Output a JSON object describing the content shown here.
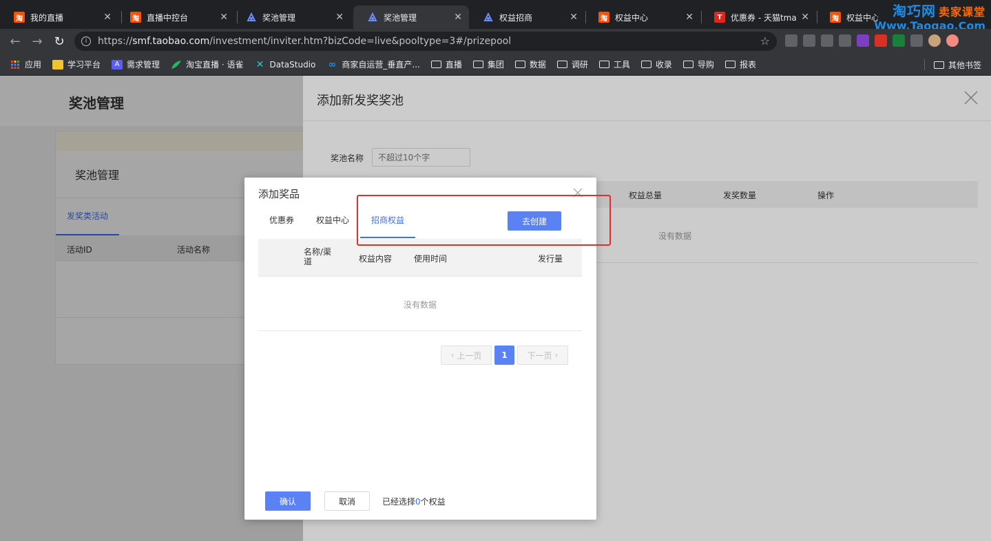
{
  "browser": {
    "tabs": [
      {
        "title": "我的直播",
        "favicon": "taobao-icon"
      },
      {
        "title": "直播中控台",
        "favicon": "taobao-icon"
      },
      {
        "title": "奖池管理",
        "favicon": "blue-logo-icon"
      },
      {
        "title": "奖池管理",
        "favicon": "blue-logo-icon",
        "active": true
      },
      {
        "title": "权益招商",
        "favicon": "blue-logo-icon"
      },
      {
        "title": "权益中心",
        "favicon": "taobao-icon"
      },
      {
        "title": "优惠券 - 天猫tmall",
        "favicon": "tmall-icon"
      },
      {
        "title": "权益中心",
        "favicon": "taobao-icon"
      }
    ],
    "favicon_letters": {
      "taobao": "淘",
      "tmall": "T"
    },
    "url": {
      "scheme": "https://",
      "host": "smf.taobao.com",
      "path": "/investment/inviter.htm?bizCode=live&pooltype=3#/prizepool"
    },
    "bookmarks": [
      {
        "label": "应用",
        "icon": "apps-grid-icon"
      },
      {
        "label": "学习平台",
        "icon": "study-icon"
      },
      {
        "label": "需求管理",
        "icon": "letter-a-icon"
      },
      {
        "label": "淘宝直播 · 语雀",
        "icon": "yuque-icon"
      },
      {
        "label": "DataStudio",
        "icon": "datastudio-icon"
      },
      {
        "label": "商家自运营_垂直产...",
        "icon": "infinity-icon"
      },
      {
        "label": "直播",
        "icon": "folder-icon"
      },
      {
        "label": "集团",
        "icon": "folder-icon"
      },
      {
        "label": "数据",
        "icon": "folder-icon"
      },
      {
        "label": "调研",
        "icon": "folder-icon"
      },
      {
        "label": "工具",
        "icon": "folder-icon"
      },
      {
        "label": "收录",
        "icon": "folder-icon"
      },
      {
        "label": "导购",
        "icon": "folder-icon"
      },
      {
        "label": "报表",
        "icon": "folder-icon"
      }
    ],
    "other_bookmarks": "其他书签"
  },
  "watermark": {
    "line1": "淘巧网",
    "line1_suffix": "卖家课堂",
    "line2": "Www.Taoqao.Com"
  },
  "page": {
    "title": "奖池管理",
    "card": {
      "title": "奖池管理",
      "tab": "发奖类活动",
      "columns": [
        "活动ID",
        "活动名称"
      ]
    }
  },
  "drawer": {
    "title": "添加新发奖奖池",
    "name_label": "奖池名称",
    "name_placeholder": "不超过10个字",
    "columns": [
      "权益总量",
      "发奖数量",
      "操作"
    ],
    "empty_text": "没有数据"
  },
  "modal": {
    "title": "添加奖品",
    "tabs": [
      "优惠券",
      "权益中心",
      "招商权益"
    ],
    "active_tab": 2,
    "create_button": "去创建",
    "columns": [
      "名称/渠道",
      "权益内容",
      "使用时间",
      "发行量"
    ],
    "empty_text": "没有数据",
    "pagination": {
      "prev": "上一页",
      "current": "1",
      "next": "下一页"
    },
    "confirm_button": "确认",
    "cancel_button": "取消",
    "selected_prefix": "已经选择",
    "selected_count": "0",
    "selected_suffix": "个权益"
  },
  "colors": {
    "primary": "#5b82f5",
    "link": "#3a6ff7",
    "highlight": "#e82b2b"
  }
}
